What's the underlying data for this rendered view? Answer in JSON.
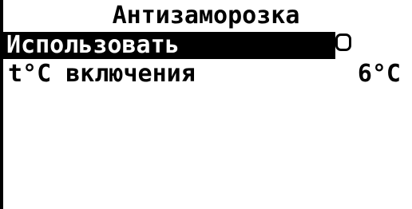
{
  "screen": {
    "title": "Антизаморозка"
  },
  "menu": {
    "items": [
      {
        "label": "Использовать",
        "checked": false,
        "selected": true
      },
      {
        "label": "t°C включения",
        "value": "6°C",
        "selected": false
      }
    ]
  },
  "colors": {
    "background": "#ffffff",
    "foreground": "#000000",
    "highlight": "#000000"
  }
}
